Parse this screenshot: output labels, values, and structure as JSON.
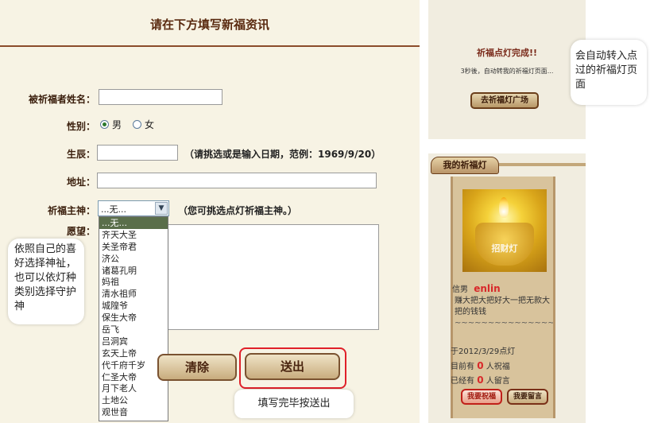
{
  "form": {
    "title": "请在下方填写新福资讯",
    "name_label": "被祈福者姓名：",
    "gender_label": "性别：",
    "gender_male": "男",
    "gender_female": "女",
    "birth_label": "生辰：",
    "birth_hint": "（请挑选或是输入日期，范例：1969/9/20）",
    "address_label": "地址：",
    "deity_label": "祈福主神：",
    "deity_selected": "...无...",
    "deity_hint": "（您可挑选点灯祈福主神。）",
    "wish_label": "愿望：",
    "clear_label": "清除",
    "submit_label": "送出"
  },
  "deity_options": [
    "...无...",
    "齐天大圣",
    "关圣帝君",
    "济公",
    "诸葛孔明",
    "妈祖",
    "清水祖师",
    "城隍爷",
    "保生大帝",
    "岳飞",
    "吕洞宾",
    "玄天上帝",
    "代千府千岁",
    "仁圣大帝",
    "月下老人",
    "土地公",
    "观世音"
  ],
  "callouts": {
    "left": "依照自己的喜好选择神祉，也可以依灯种类别选择守护神",
    "bottom": "填写完毕按送出",
    "right": "会自动转入点过的祈福灯页面"
  },
  "done_panel": {
    "title": "祈福点灯完成!!",
    "message": "3秒後，自动转我的祈福灯页面...",
    "plaza_button": "去祈福灯广场"
  },
  "my_lamp": {
    "tab_label": "我的祈福灯",
    "lamp_stamp": "招财灯",
    "gender": "信男",
    "user": "enlin",
    "wish": "赚大把大把好大一把无款大把的钱钱",
    "divider": "~~~~~~~~~~~~~~~~~~~~~~~~",
    "lit_date": "于2012/3/29点灯",
    "blessers_prefix": "目前有",
    "blessers_count": "0",
    "blessers_suffix": "人祝福",
    "messages_prefix": "已经有",
    "messages_count": "0",
    "messages_suffix": "人留言",
    "bless_button": "我要祝福",
    "comment_button": "我要留言"
  }
}
